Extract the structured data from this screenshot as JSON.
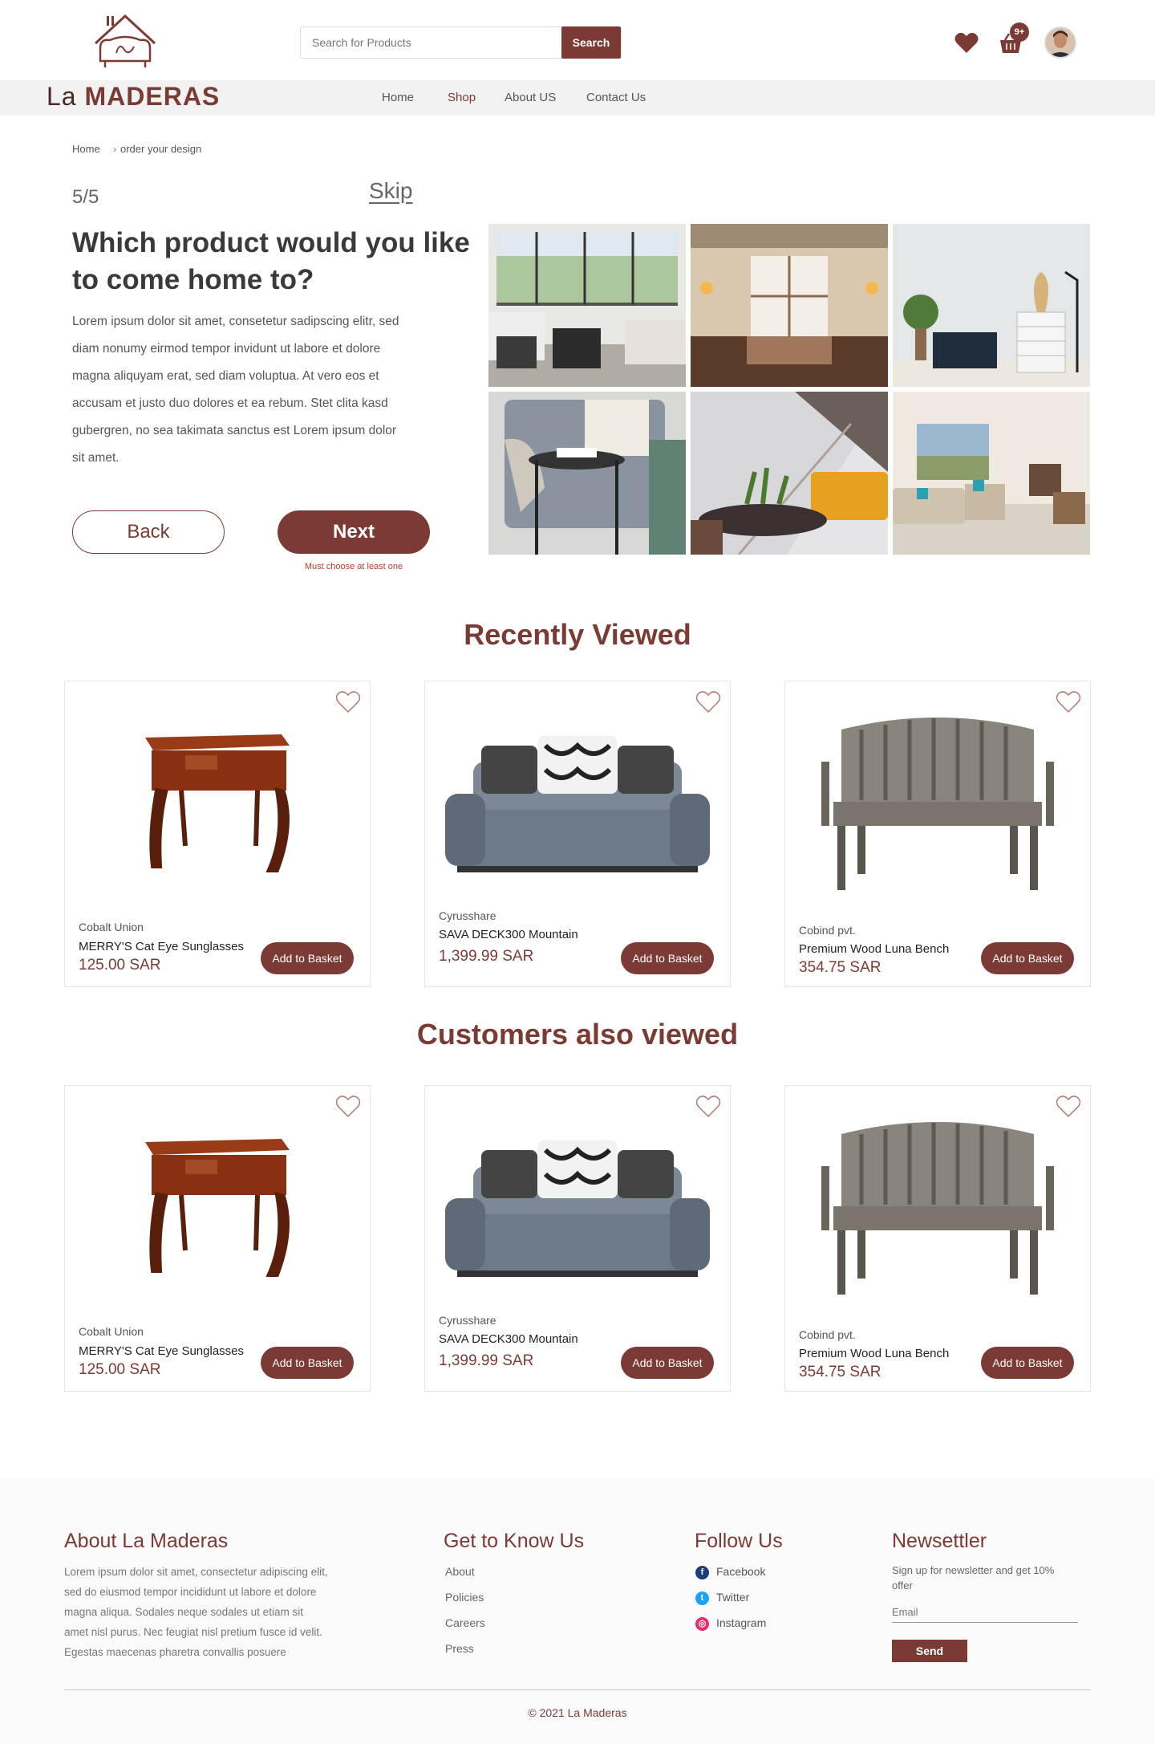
{
  "header": {
    "logo_prefix": "La",
    "logo_name": "MADERAS",
    "search_placeholder": "Search for Products",
    "search_button": "Search",
    "cart_badge": "9+",
    "nav": [
      {
        "label": "Home",
        "active": false
      },
      {
        "label": "Shop",
        "active": true
      },
      {
        "label": "About US",
        "active": false
      },
      {
        "label": "Contact Us",
        "active": false
      }
    ]
  },
  "breadcrumb": {
    "home": "Home",
    "current": "order your design"
  },
  "quiz": {
    "step": "5/5",
    "skip": "Skip",
    "question": "Which product would you like to come home to?",
    "description": "Lorem ipsum dolor sit amet, consetetur sadipscing elitr, sed diam nonumy eirmod tempor invidunt ut labore et dolore magna aliquyam erat, sed diam voluptua. At vero eos et accusam et justo duo dolores et ea rebum. Stet clita kasd gubergren, no sea takimata sanctus est Lorem ipsum dolor sit amet.",
    "back_label": "Back",
    "next_label": "Next",
    "error": "Must choose at least one"
  },
  "recently_viewed": {
    "title": "Recently Viewed",
    "products": [
      {
        "brand": "Cobalt Union",
        "name": "MERRY'S Cat Eye Sunglasses",
        "price": "125.00 SAR",
        "button": "Add to Basket"
      },
      {
        "brand": "Cyrusshare",
        "name": "SAVA DECK300 Mountain",
        "price": "1,399.99 SAR",
        "button": "Add to Basket"
      },
      {
        "brand": "Cobind pvt.",
        "name": "Premium Wood Luna Bench",
        "price": "354.75 SAR",
        "button": "Add to Basket"
      }
    ]
  },
  "customers_viewed": {
    "title": "Customers also viewed",
    "products": [
      {
        "brand": "Cobalt Union",
        "name": "MERRY'S Cat Eye Sunglasses",
        "price": "125.00 SAR",
        "button": "Add to Basket"
      },
      {
        "brand": "Cyrusshare",
        "name": "SAVA DECK300 Mountain",
        "price": "1,399.99 SAR",
        "button": "Add to Basket"
      },
      {
        "brand": "Cobind pvt.",
        "name": "Premium Wood Luna Bench",
        "price": "354.75 SAR",
        "button": "Add to Basket"
      }
    ]
  },
  "footer": {
    "about_title": "About La Maderas",
    "about_text": "Lorem ipsum dolor sit amet, consectetur adipiscing elit, sed do eiusmod tempor incididunt ut labore et dolore magna aliqua. Sodales neque sodales ut etiam sit amet nisl purus. Nec feugiat nisl pretium fusce id velit. Egestas maecenas pharetra convallis posuere",
    "know_title": "Get to Know Us",
    "know_links": [
      "About",
      "Policies",
      "Careers",
      "Press"
    ],
    "follow_title": "Follow Us",
    "follow_links": [
      "Facebook",
      "Twitter",
      "Instagram"
    ],
    "news_title": "Newsettler",
    "news_text": "Sign up for newsletter and get 10% offer",
    "email_placeholder": "Email",
    "send_label": "Send",
    "copyright": "© 2021 La Maderas"
  },
  "colors": {
    "accent": "#7b3b34",
    "nav_bg": "#f2f2f2"
  }
}
